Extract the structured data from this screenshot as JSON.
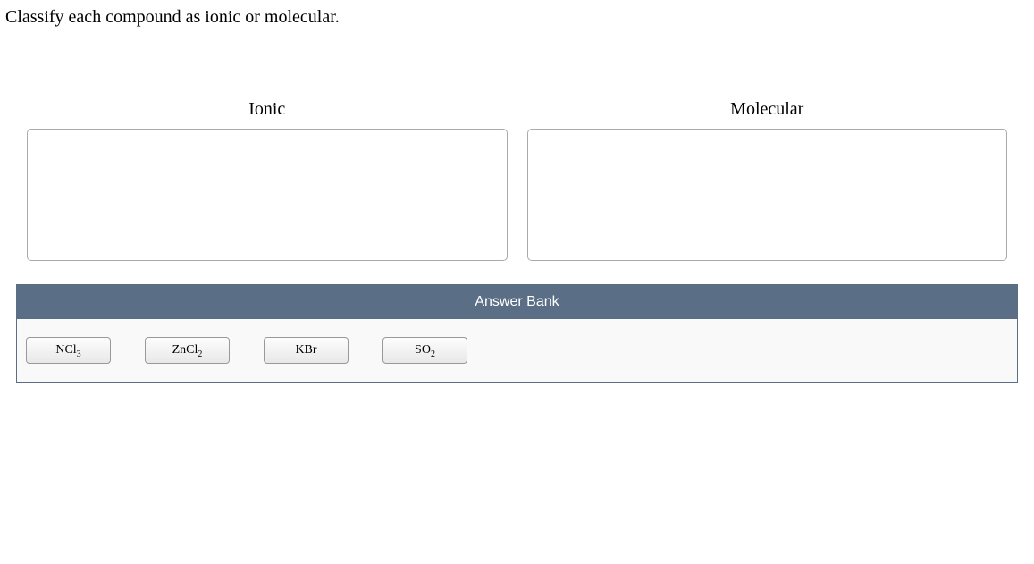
{
  "question": "Classify each compound as ionic or molecular.",
  "categories": {
    "left": {
      "label": "Ionic"
    },
    "right": {
      "label": "Molecular"
    }
  },
  "answerBank": {
    "title": "Answer Bank",
    "items": [
      {
        "base": "NCl",
        "sub": "3"
      },
      {
        "base": "ZnCl",
        "sub": "2"
      },
      {
        "base": "KBr",
        "sub": ""
      },
      {
        "base": "SO",
        "sub": "2"
      }
    ]
  }
}
